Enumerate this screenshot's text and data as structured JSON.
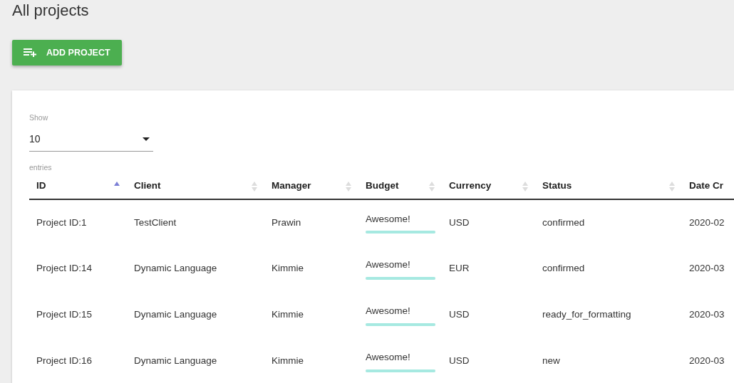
{
  "page_title": "All projects",
  "add_button": {
    "label": "ADD PROJECT"
  },
  "length_select": {
    "label": "Show",
    "value": "10",
    "suffix": "entries"
  },
  "table": {
    "columns": [
      {
        "label": "ID",
        "sorted": true
      },
      {
        "label": "Client",
        "sorted": false
      },
      {
        "label": "Manager",
        "sorted": false
      },
      {
        "label": "Budget",
        "sorted": false
      },
      {
        "label": "Currency",
        "sorted": false
      },
      {
        "label": "Status",
        "sorted": false
      },
      {
        "label": "Date Cr"
      }
    ],
    "rows": [
      {
        "id": "Project ID:1",
        "client": "TestClient",
        "manager": "Prawin",
        "budget": {
          "label": "Awesome!",
          "level": 1
        },
        "currency": "USD",
        "status": "confirmed",
        "date": "2020-02"
      },
      {
        "id": "Project ID:14",
        "client": "Dynamic Language",
        "manager": "Kimmie",
        "budget": {
          "label": "Awesome!",
          "level": 1
        },
        "currency": "EUR",
        "status": "confirmed",
        "date": "2020-03"
      },
      {
        "id": "Project ID:15",
        "client": "Dynamic Language",
        "manager": "Kimmie",
        "budget": {
          "label": "Awesome!",
          "level": 1
        },
        "currency": "USD",
        "status": "ready_for_formatting",
        "date": "2020-03"
      },
      {
        "id": "Project ID:16",
        "client": "Dynamic Language",
        "manager": "Kimmie",
        "budget": {
          "label": "Awesome!",
          "level": 1
        },
        "currency": "USD",
        "status": "new",
        "date": "2020-03"
      }
    ]
  }
}
